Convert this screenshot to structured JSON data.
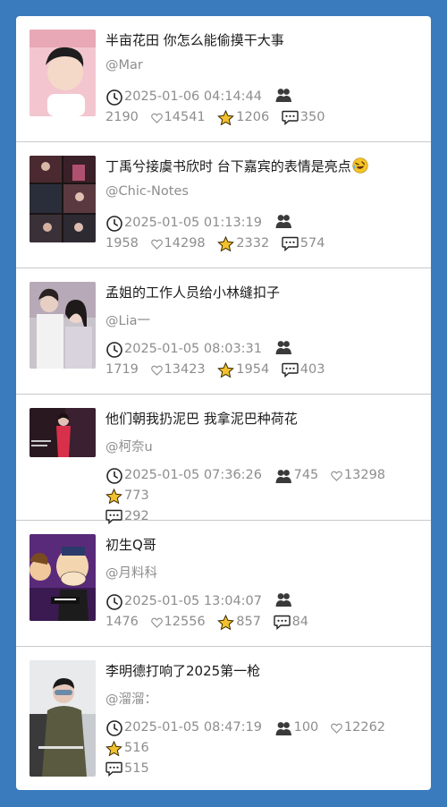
{
  "colors": {
    "page_background": "#3a7bbd",
    "card_background": "#ffffff",
    "meta_text": "#8d8d8d",
    "star": "#f2c12e"
  },
  "icons": {
    "time": "clock-icon",
    "users": "group-icon",
    "likes": "heart-icon",
    "favorites": "star-icon",
    "comments": "comment-icon"
  },
  "posts": [
    {
      "title": "半亩花田 你怎么能偷摸干大事",
      "author": "@Mar",
      "time": "2025-01-06 04:14:44",
      "views": "2190",
      "likes": "14541",
      "favorites": "1206",
      "comments": "350"
    },
    {
      "title": "丁禹兮接虞书欣时 台下嘉宾的表情是亮点",
      "title_emoji": "rolling-laughing-emoji",
      "author": "@Chic-Notes",
      "time": "2025-01-05 01:13:19",
      "views": "1958",
      "likes": "14298",
      "favorites": "2332",
      "comments": "574"
    },
    {
      "title": "孟姐的工作人员给小林缝扣子",
      "author": "@Lia一",
      "time": "2025-01-05 08:03:31",
      "views": "1719",
      "likes": "13423",
      "favorites": "1954",
      "comments": "403"
    },
    {
      "title": "他们朝我扔泥巴 我拿泥巴种荷花",
      "author": "@柯奈u",
      "time": "2025-01-05 07:36:26",
      "views": "745",
      "likes": "13298",
      "favorites": "773",
      "comments": "292"
    },
    {
      "title": "初生Q哥",
      "author": "@月料科",
      "time": "2025-01-05 13:04:07",
      "views": "1476",
      "likes": "12556",
      "favorites": "857",
      "comments": "84"
    },
    {
      "title": "李明德打响了2025第一枪",
      "author": "@溜溜：",
      "time": "2025-01-05 08:47:19",
      "views": "100",
      "likes": "12262",
      "favorites": "516",
      "comments": "515"
    }
  ]
}
